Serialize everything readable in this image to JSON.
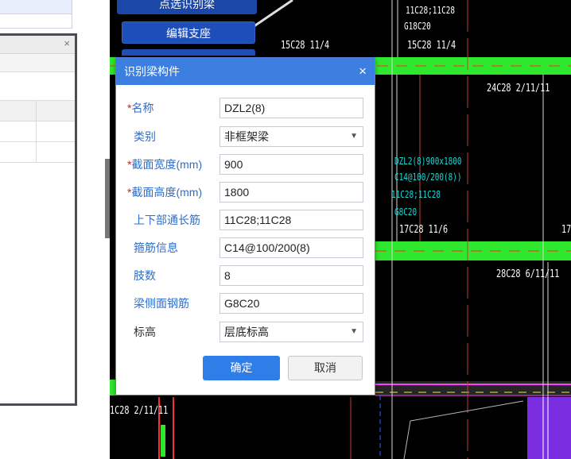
{
  "toolbar": {
    "pick_beam_label": "点选识别梁",
    "edit_support_label": "编辑支座"
  },
  "dialog": {
    "title": "识别梁构件",
    "close_glyph": "×",
    "fields": [
      {
        "label": "名称",
        "required": true,
        "value": "DZL2(8)",
        "type": "text"
      },
      {
        "label": "类别",
        "required": false,
        "value": "非框架梁",
        "type": "select"
      },
      {
        "label": "截面宽度(mm)",
        "required": true,
        "value": "900",
        "type": "text"
      },
      {
        "label": "截面高度(mm)",
        "required": true,
        "value": "1800",
        "type": "text"
      },
      {
        "label": "上下部通长筋",
        "required": false,
        "value": "11C28;11C28",
        "type": "text"
      },
      {
        "label": "箍筋信息",
        "required": false,
        "value": "C14@100/200(8)",
        "type": "text"
      },
      {
        "label": "肢数",
        "required": false,
        "value": "8",
        "type": "text"
      },
      {
        "label": "梁侧面钢筋",
        "required": false,
        "value": "G8C20",
        "type": "text"
      },
      {
        "label": "标高",
        "required": false,
        "value": "层底标高",
        "type": "select"
      }
    ],
    "required_mark": "*",
    "ok_label": "确定",
    "cancel_label": "取消"
  },
  "side_window": {
    "close_glyph": "×"
  },
  "drawing": {
    "annotations": {
      "top_rebar_1": "11C28;11C28",
      "top_rebar_2": "G18C20",
      "top_span_left": "15C28  11/4",
      "top_span_right": "15C28  11/4",
      "upper_bottom_bars": "24C28 2/11/11",
      "beam_name": "DZL2(8)900x1800",
      "beam_stirrups": "C14@100/200(8))",
      "beam_long": "11C28;11C28",
      "beam_side": "G8C20",
      "mid_span": "17C28  11/6",
      "mid_span_edge": "17",
      "lower_bottom_bars": "28C28 6/11/11",
      "bottom_left_bars": "1C28 2/11/11"
    }
  },
  "colors": {
    "dialog_title_bg": "#3c7fe0",
    "ok_button": "#2f7de8",
    "beam_highlight": "#2ee82e",
    "cad_background": "#000000",
    "annotation_cyan": "#18d8d8",
    "required_mark": "#d62020"
  }
}
